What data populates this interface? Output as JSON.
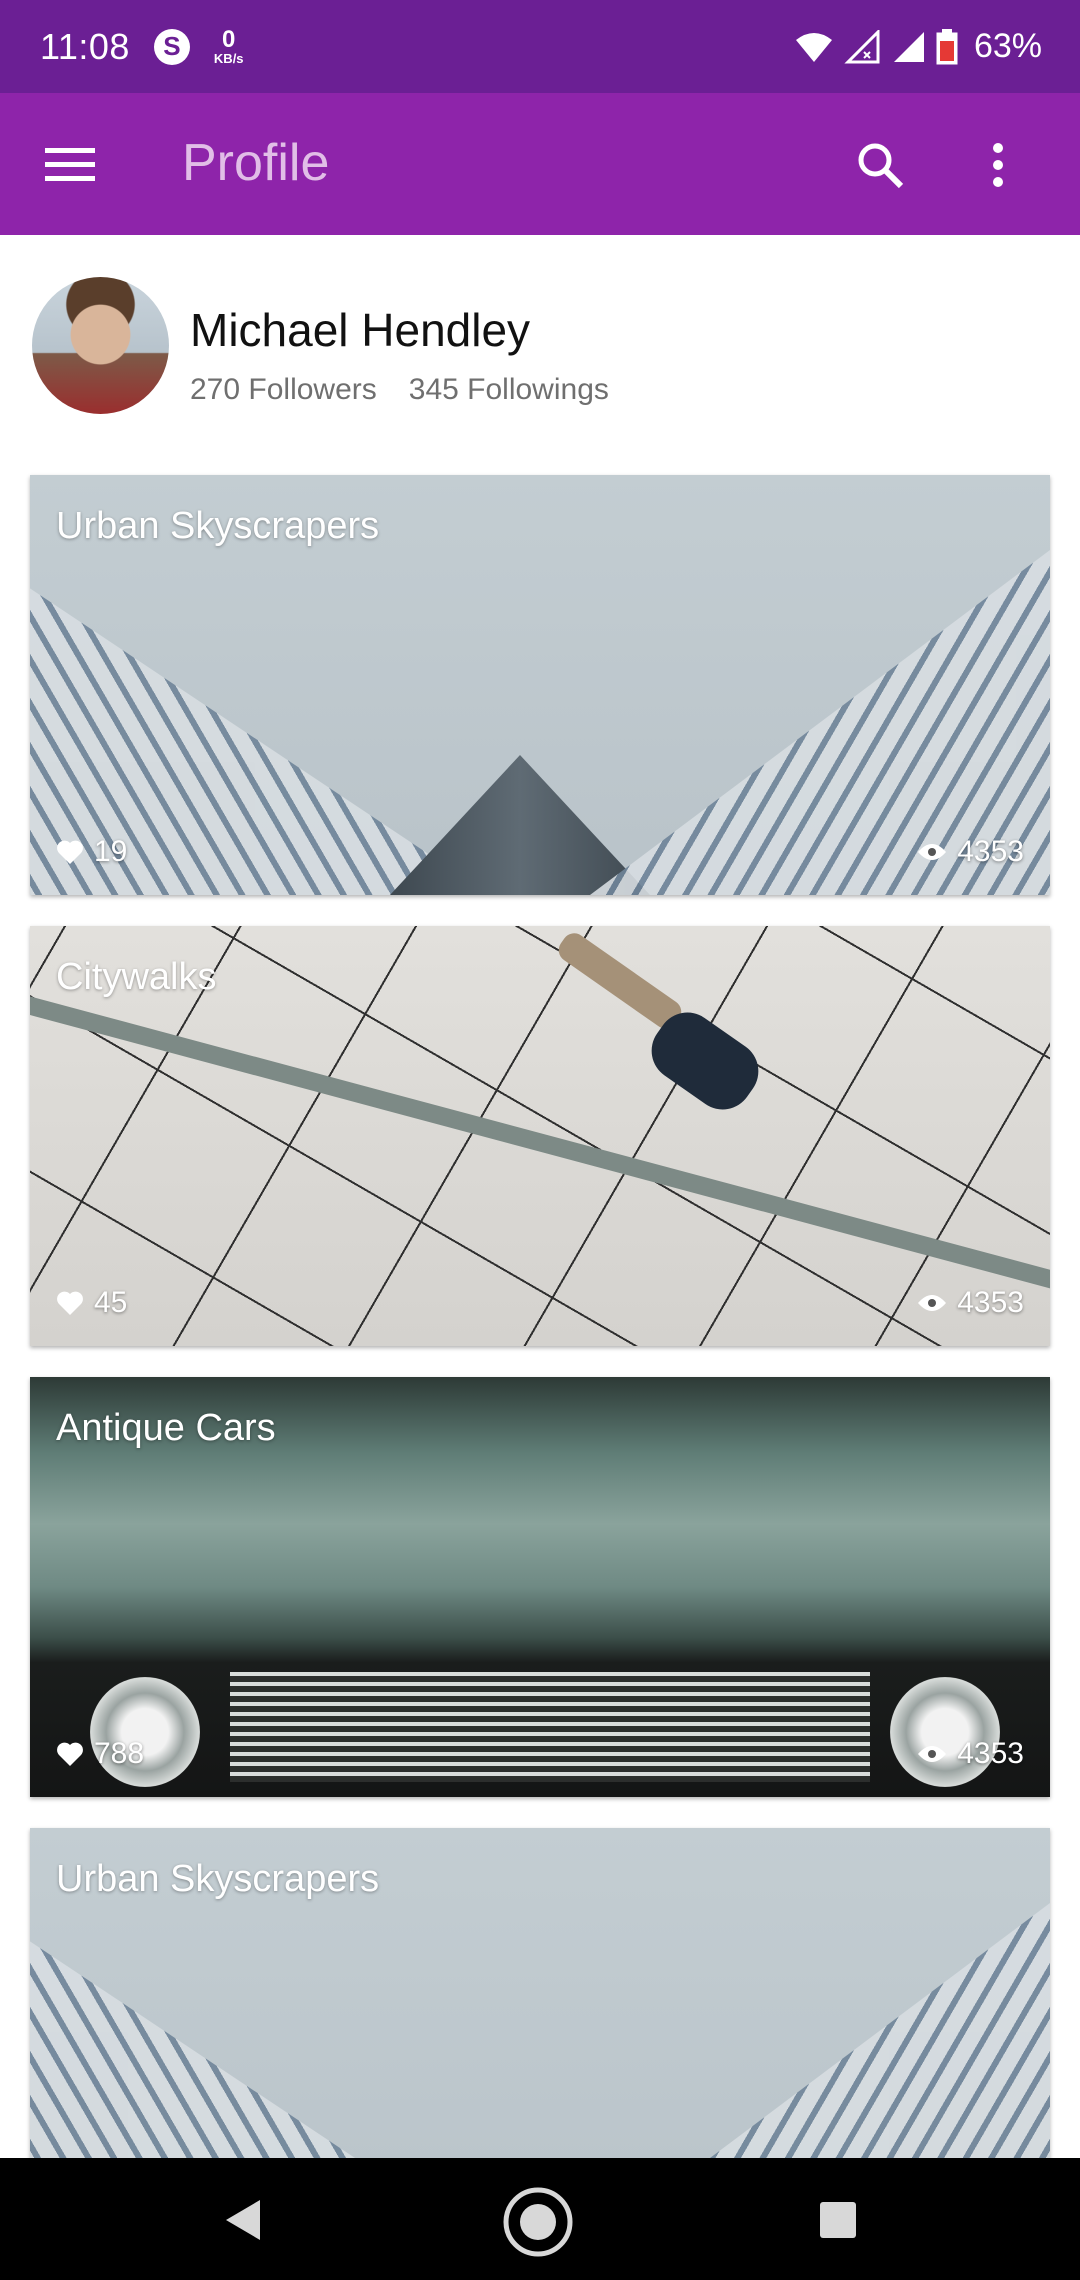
{
  "status_bar": {
    "time": "11:08",
    "skype_letter": "S",
    "net_speed_value": "0",
    "net_speed_unit": "KB/s",
    "battery_percent": "63%"
  },
  "app_bar": {
    "title": "Profile",
    "background_color": "#8e24aa",
    "icons": [
      "menu-icon",
      "search-icon",
      "more-vertical-icon"
    ]
  },
  "profile": {
    "name": "Michael Hendley",
    "followers": "270 Followers",
    "followings": "345 Followings"
  },
  "cards": [
    {
      "title": "Urban Skyscrapers",
      "likes": "19",
      "views": "4353",
      "image": "skyscrapers"
    },
    {
      "title": "Citywalks",
      "likes": "45",
      "views": "4353",
      "image": "citywalk"
    },
    {
      "title": "Antique Cars",
      "likes": "788",
      "views": "4353",
      "image": "antique-car"
    },
    {
      "title": "Urban Skyscrapers",
      "likes": "",
      "views": "",
      "image": "skyscrapers"
    }
  ],
  "nav_bar": {
    "icons": [
      "back-icon",
      "home-icon",
      "recents-icon"
    ]
  }
}
